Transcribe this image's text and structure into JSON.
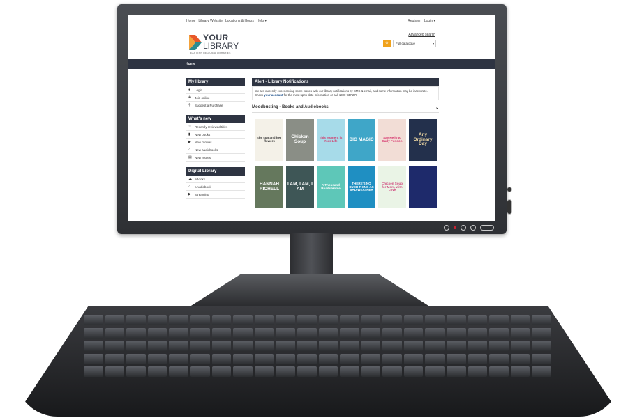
{
  "nav": {
    "left": [
      "Home",
      "Library Website",
      "Locations & Hours",
      "Help ▾"
    ],
    "right": [
      "Register",
      "Login ▾"
    ]
  },
  "logo": {
    "line1": "YOUR",
    "line2": "LIBRARY",
    "line3": "EASTERN REGIONAL LIBRARIES"
  },
  "search": {
    "advanced": "Advanced search",
    "scope": "Full catalogue",
    "button_icon": "search-icon"
  },
  "homebar": "Home",
  "sidebar": {
    "my_library": {
      "title": "My library",
      "items": [
        {
          "icon": "user-icon",
          "label": "Login"
        },
        {
          "icon": "add-user-icon",
          "label": "Join online"
        },
        {
          "icon": "magnify-icon",
          "label": "Suggest a Purchase"
        }
      ]
    },
    "whats_new": {
      "title": "What's new",
      "items": [
        {
          "icon": "star-icon",
          "label": "Recently reviewed titles"
        },
        {
          "icon": "book-icon",
          "label": "New books"
        },
        {
          "icon": "video-icon",
          "label": "New movies"
        },
        {
          "icon": "headphones-icon",
          "label": "New audiobooks"
        },
        {
          "icon": "newspaper-icon",
          "label": "New issues"
        }
      ]
    },
    "digital": {
      "title": "Digital Library",
      "items": [
        {
          "icon": "cloud-icon",
          "label": "eBooks"
        },
        {
          "icon": "headphones-icon",
          "label": "eAudiobook"
        },
        {
          "icon": "play-icon",
          "label": "Streaming"
        }
      ]
    }
  },
  "alert": {
    "title": "Alert - Library Notifications",
    "text1": "We are currently experiencing some issues with our library notifications by SMS & email, and some information may be inaccurate. Check",
    "link": "your account",
    "text2": "for the most up to date information or call 1300 737 277"
  },
  "moodbusting": {
    "title": "Moodbusting - Books and Audiobooks",
    "books": [
      {
        "title": "the sun and her flowers",
        "bg": "#f4f1e8",
        "fg": "#333"
      },
      {
        "title": "Chicken Soup",
        "bg": "#8a8e86",
        "fg": "#fff"
      },
      {
        "title": "This Moment is Your Life",
        "bg": "#a7dbe9",
        "fg": "#d23a6b"
      },
      {
        "title": "BIG MAGIC",
        "bg": "#3fa6c8",
        "fg": "#fff"
      },
      {
        "title": "Say Hello to Carly Fondon",
        "bg": "#f2ddd6",
        "fg": "#d6336c"
      },
      {
        "title": "Any Ordinary Day",
        "bg": "#23304c",
        "fg": "#f0d9a3"
      },
      {
        "title": "HANNAH RICHELL",
        "bg": "#65785d",
        "fg": "#fff"
      },
      {
        "title": "I AM, I AM, I AM",
        "bg": "#3e5656",
        "fg": "#fff"
      },
      {
        "title": "A Thousand Roads Home",
        "bg": "#5ec7b8",
        "fg": "#fff"
      },
      {
        "title": "THERE'S NO SUCH THING AS BAD WEATHER",
        "bg": "#1f8fc2",
        "fg": "#fff"
      },
      {
        "title": "Chicken Soup for Mom, with Love",
        "bg": "#eaf4e6",
        "fg": "#d04a7f"
      },
      {
        "title": "",
        "bg": "#1e2a6b",
        "fg": "#9ab"
      }
    ]
  }
}
